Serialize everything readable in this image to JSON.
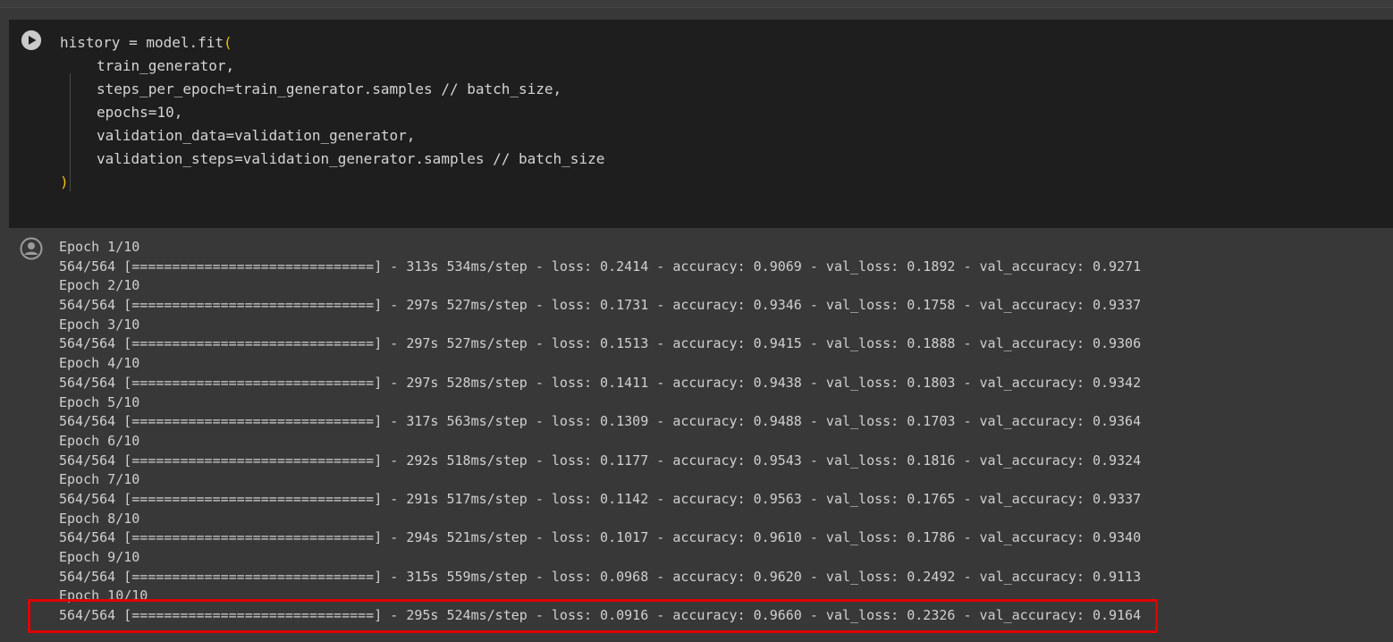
{
  "code_cell": {
    "run_icon": "play-circle-icon",
    "lines": [
      {
        "pre": "history = model.fit",
        "paren": "(",
        "indent": false
      },
      {
        "pre": "train_generator,",
        "paren": "",
        "indent": true
      },
      {
        "pre": "steps_per_epoch=train_generator.samples // batch_size,",
        "paren": "",
        "indent": true
      },
      {
        "pre": "epochs=10,",
        "paren": "",
        "indent": true
      },
      {
        "pre": "validation_data=validation_generator,",
        "paren": "",
        "indent": true
      },
      {
        "pre": "validation_steps=validation_generator.samples // batch_size",
        "paren": "",
        "indent": true
      },
      {
        "pre": "",
        "paren": ")",
        "indent": false
      }
    ]
  },
  "output": {
    "icon": "output-user-icon",
    "lines": [
      "Epoch 1/10",
      "564/564 [==============================] - 313s 534ms/step - loss: 0.2414 - accuracy: 0.9069 - val_loss: 0.1892 - val_accuracy: 0.9271",
      "Epoch 2/10",
      "564/564 [==============================] - 297s 527ms/step - loss: 0.1731 - accuracy: 0.9346 - val_loss: 0.1758 - val_accuracy: 0.9337",
      "Epoch 3/10",
      "564/564 [==============================] - 297s 527ms/step - loss: 0.1513 - accuracy: 0.9415 - val_loss: 0.1888 - val_accuracy: 0.9306",
      "Epoch 4/10",
      "564/564 [==============================] - 297s 528ms/step - loss: 0.1411 - accuracy: 0.9438 - val_loss: 0.1803 - val_accuracy: 0.9342",
      "Epoch 5/10",
      "564/564 [==============================] - 317s 563ms/step - loss: 0.1309 - accuracy: 0.9488 - val_loss: 0.1703 - val_accuracy: 0.9364",
      "Epoch 6/10",
      "564/564 [==============================] - 292s 518ms/step - loss: 0.1177 - accuracy: 0.9543 - val_loss: 0.1816 - val_accuracy: 0.9324",
      "Epoch 7/10",
      "564/564 [==============================] - 291s 517ms/step - loss: 0.1142 - accuracy: 0.9563 - val_loss: 0.1765 - val_accuracy: 0.9337",
      "Epoch 8/10",
      "564/564 [==============================] - 294s 521ms/step - loss: 0.1017 - accuracy: 0.9610 - val_loss: 0.1786 - val_accuracy: 0.9340",
      "Epoch 9/10",
      "564/564 [==============================] - 315s 559ms/step - loss: 0.0968 - accuracy: 0.9620 - val_loss: 0.2492 - val_accuracy: 0.9113",
      "Epoch 10/10",
      "564/564 [==============================] - 295s 524ms/step - loss: 0.0916 - accuracy: 0.9660 - val_loss: 0.2326 - val_accuracy: 0.9164"
    ]
  },
  "colors": {
    "cell_bg": "#1e1e1e",
    "output_bg": "#383838",
    "paren": "#f0c000",
    "highlight": "#e00000"
  }
}
